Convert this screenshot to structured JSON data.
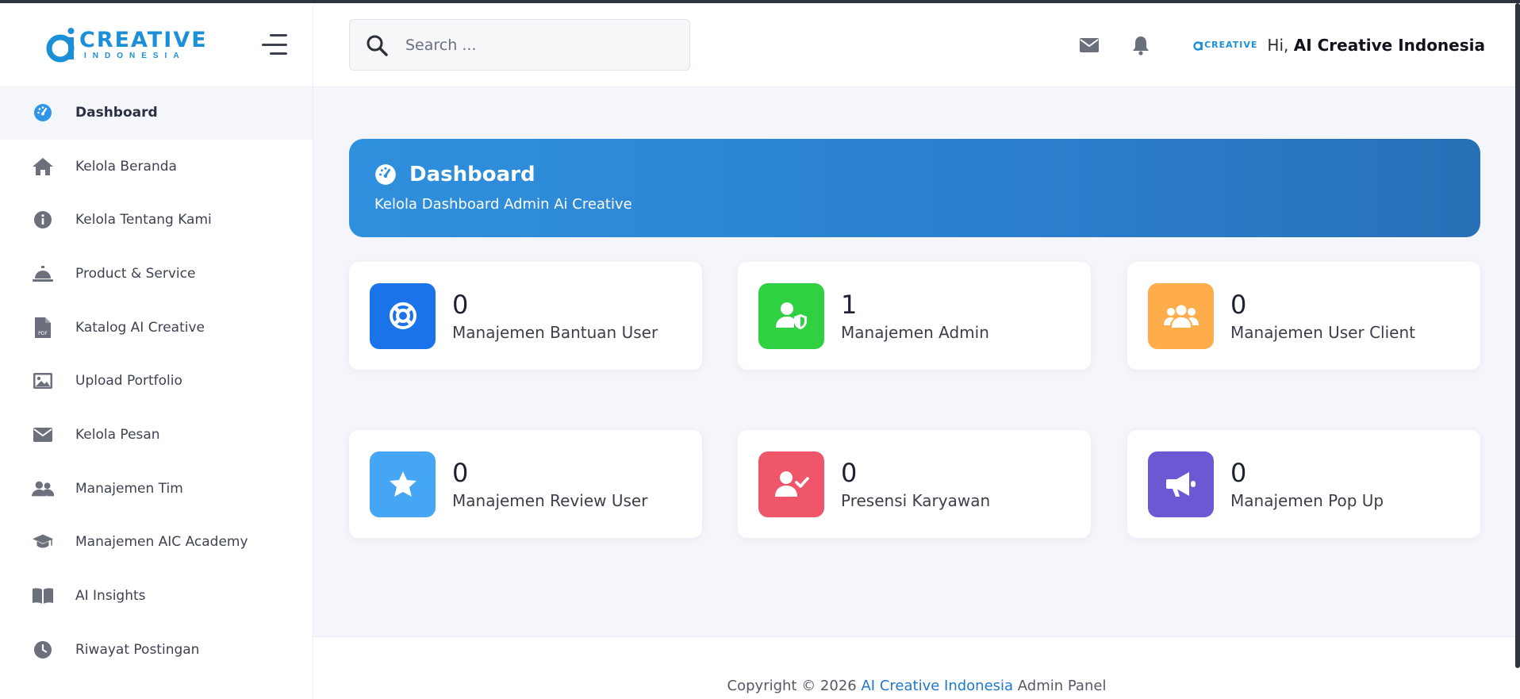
{
  "brand": {
    "name": "CREATIVE",
    "tagline": "INDONESIA",
    "mini": "CREATIVE"
  },
  "colors": {
    "primary": "#1b8fd8",
    "banner": "#2f90de",
    "blue": "#1a73e8",
    "green": "#2fd143",
    "orange": "#ffad4a",
    "lightblue": "#45a6f5",
    "red": "#f0566a",
    "purple": "#6b59d3"
  },
  "sidebar": {
    "items": [
      {
        "label": "Dashboard",
        "icon": "dashboard-icon",
        "active": true
      },
      {
        "label": "Kelola Beranda",
        "icon": "home-icon"
      },
      {
        "label": "Kelola Tentang Kami",
        "icon": "info-icon"
      },
      {
        "label": "Product & Service",
        "icon": "service-bell-icon"
      },
      {
        "label": "Katalog AI Creative",
        "icon": "pdf-file-icon"
      },
      {
        "label": "Upload Portfolio",
        "icon": "image-icon"
      },
      {
        "label": "Kelola Pesan",
        "icon": "envelope-icon"
      },
      {
        "label": "Manajemen Tim",
        "icon": "users-icon"
      },
      {
        "label": "Manajemen AIC Academy",
        "icon": "graduation-cap-icon"
      },
      {
        "label": "AI Insights",
        "icon": "book-icon"
      },
      {
        "label": "Riwayat Postingan",
        "icon": "clock-icon"
      }
    ]
  },
  "header": {
    "search_placeholder": "Search ...",
    "greeting": "Hi,",
    "user_name": "AI Creative Indonesia"
  },
  "banner": {
    "title": "Dashboard",
    "subtitle": "Kelola Dashboard Admin Ai Creative"
  },
  "cards": [
    {
      "value": "0",
      "label": "Manajemen Bantuan User",
      "icon": "lifebuoy-icon"
    },
    {
      "value": "1",
      "label": "Manajemen Admin",
      "icon": "user-shield-icon"
    },
    {
      "value": "0",
      "label": "Manajemen User Client",
      "icon": "user-group-icon"
    },
    {
      "value": "0",
      "label": "Manajemen Review User",
      "icon": "star-icon"
    },
    {
      "value": "0",
      "label": "Presensi Karyawan",
      "icon": "user-check-icon"
    },
    {
      "value": "0",
      "label": "Manajemen Pop Up",
      "icon": "megaphone-icon"
    }
  ],
  "footer": {
    "prefix": "Copyright © 2026",
    "link": "AI Creative Indonesia",
    "suffix": "Admin Panel"
  }
}
